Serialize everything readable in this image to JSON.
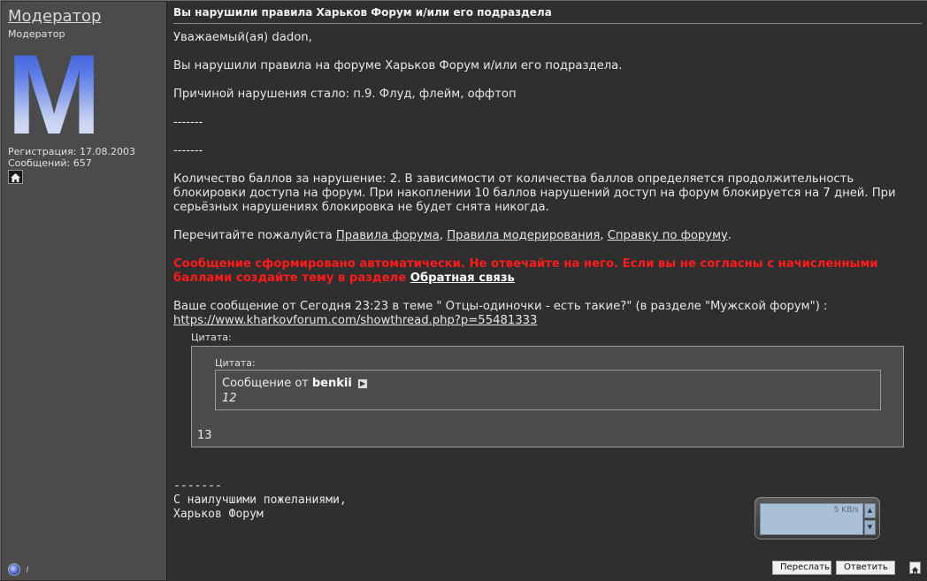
{
  "user": {
    "name": "Модератор",
    "title": "Модератор",
    "avatar_letter": "M",
    "registration": "Регистрация: 17.08.2003",
    "posts": "Сообщений: 657"
  },
  "post": {
    "title": "Вы нарушили правила Харьков Форум и/или его подраздела",
    "greeting": "Уважаемый(ая) dadon,",
    "violation": "Вы нарушили правила на форуме Харьков Форум и/или его подраздела.",
    "reason": "Причиной нарушения стало: п.9. Флуд, флейм, оффтоп",
    "divider1": "-------",
    "divider2": "-------",
    "points": "Количество баллов за нарушение: 2. В зависимости от количества баллов определяется продолжительность блокировки доступа на форум. При накоплении 10 баллов нарушений доступ на форум блокируется на 7 дней. При серьёзных нарушениях блокировка не будет снята никогда.",
    "reread_prefix": "Перечитайте пожалуйста",
    "links": {
      "rules": "Правила форума",
      "moderation": "Правила модерирования",
      "help": "Справку по форуму"
    },
    "sep_comma": ",",
    "sep_period": ".",
    "warning_text": "Сообщение сформировано автоматически. Не отвечайте на него. Если вы не согласны с начисленными баллами создайте тему в разделе",
    "feedback_link": "Обратная связь",
    "your_message": "Ваше сообщение от Сегодня 23:23 в теме \" Отцы-одиночки - есть такие?\" (в разделе \"Мужской форум\") :",
    "message_url": "https://www.kharkovforum.com/showthread.php?p=55481333"
  },
  "quote": {
    "outer_label": "Цитата:",
    "inner_label": "Цитата:",
    "from_prefix": "Сообщение от",
    "from_user": "benkii",
    "inner_text": "12",
    "outer_text": "13"
  },
  "signature": {
    "divider": "-------",
    "line1": "С наилучшими пожеланиями,",
    "line2": "Харьков Форум"
  },
  "speed_widget": {
    "speed": "5 KB/s"
  },
  "buttons": {
    "forward": "Переслать",
    "reply": "Ответить"
  }
}
